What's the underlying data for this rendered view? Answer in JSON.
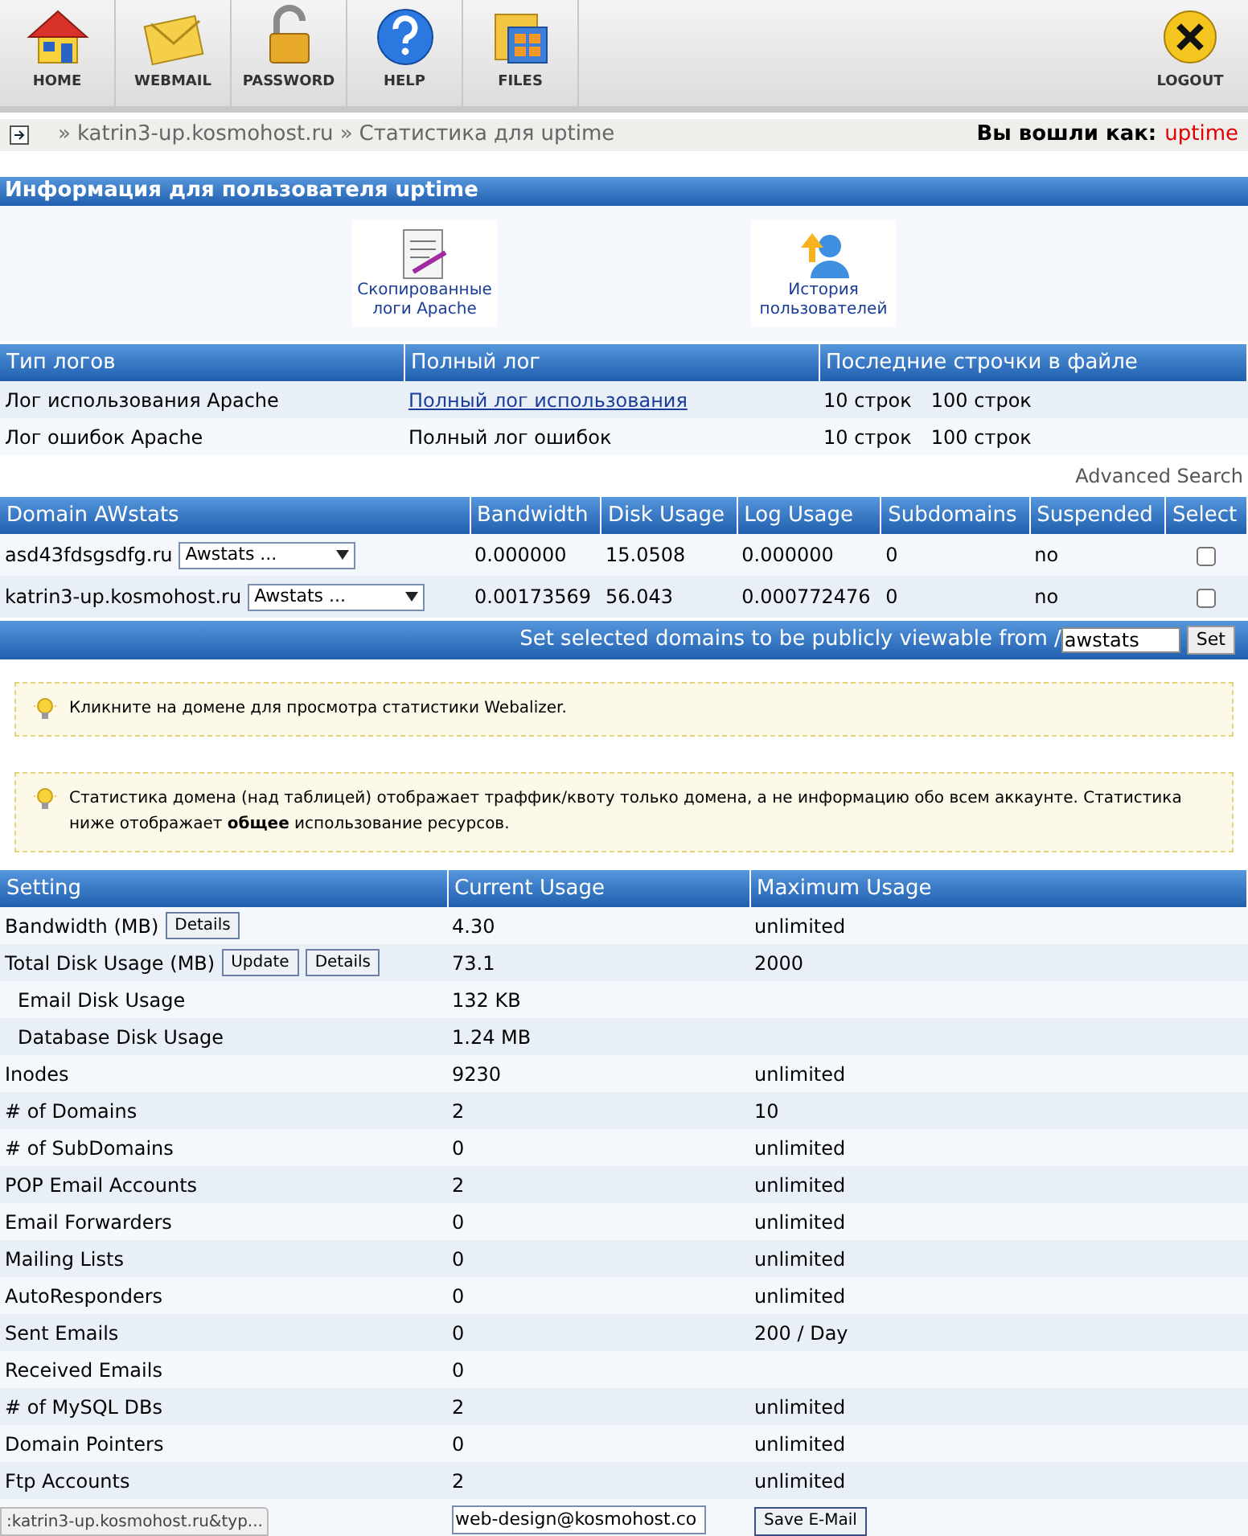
{
  "toolbar": {
    "items": [
      {
        "label": "HOME"
      },
      {
        "label": "WEBMAIL"
      },
      {
        "label": "PASSWORD"
      },
      {
        "label": "HELP"
      },
      {
        "label": "FILES"
      }
    ],
    "logout": {
      "label": "LOGOUT"
    }
  },
  "breadcrumb": {
    "separator": "»",
    "items": [
      "katrin3-up.kosmohost.ru",
      "Статистика для uptime"
    ],
    "logged_in_label": "Вы вошли как:",
    "user": "uptime"
  },
  "section_title": "Информация для пользователя uptime",
  "shortcuts": [
    {
      "label": "Скопированные логи Apache"
    },
    {
      "label": "История пользователей"
    }
  ],
  "logs_table": {
    "columns": [
      "Тип логов",
      "Полный лог",
      "Последние строчки в файле"
    ],
    "rows": [
      {
        "type": "Лог использования Apache",
        "full_log": "Полный лог использования",
        "kind": "link",
        "lines": [
          "10 строк",
          "100 строк"
        ]
      },
      {
        "type": "Лог ошибок Apache",
        "full_log": "Полный лог ошибок",
        "kind": "text",
        "lines": [
          "10 строк",
          "100 строк"
        ]
      }
    ]
  },
  "advanced_search": "Advanced Search",
  "domains_table": {
    "columns": [
      "Domain AWstats",
      "Bandwidth",
      "Disk Usage",
      "Log Usage",
      "Subdomains",
      "Suspended",
      "Select"
    ],
    "rows": [
      {
        "domain": "asd43fdsgsdfg.ru",
        "stats_select": "Awstats ...",
        "bandwidth": "0.000000",
        "disk": "15.0508",
        "log": "0.000000",
        "subdomains": "0",
        "suspended": "no",
        "checked": false
      },
      {
        "domain": "katrin3-up.kosmohost.ru",
        "stats_select": "Awstats ...",
        "bandwidth": "0.00173569",
        "disk": "56.043",
        "log": "0.000772476",
        "subdomains": "0",
        "suspended": "no",
        "checked": false
      }
    ]
  },
  "public_bar": {
    "label": "Set selected domains to be publicly viewable from /",
    "value": "awstats",
    "button": "Set"
  },
  "notes": [
    {
      "text": "Кликните на домене для просмотра статистики Webalizer."
    },
    {
      "text": "Статистика домена (над таблицей) отображает траффик/квоту только домена, а не информацию обо всем аккаунте. Статистика ниже отображает **общее** использование ресурсов."
    }
  ],
  "usage_table": {
    "columns": [
      "Setting",
      "Current Usage",
      "Maximum Usage"
    ],
    "rows": [
      {
        "setting": "Bandwidth (MB)",
        "indented": false,
        "buttons": [
          "Details"
        ],
        "current": "4.30",
        "maximum": "unlimited"
      },
      {
        "setting": "Total Disk Usage (MB)",
        "indented": false,
        "buttons": [
          "Update",
          "Details"
        ],
        "current": "73.1",
        "maximum": "2000"
      },
      {
        "setting": "Email Disk Usage",
        "indented": true,
        "current": "132 KB"
      },
      {
        "setting": "Database Disk Usage",
        "indented": true,
        "current": "1.24 MB"
      },
      {
        "setting": "Inodes",
        "indented": false,
        "current": "9230",
        "maximum": "unlimited"
      },
      {
        "setting": "# of Domains",
        "indented": false,
        "current": "2",
        "maximum": "10"
      },
      {
        "setting": "# of SubDomains",
        "indented": false,
        "current": "0",
        "maximum": "unlimited"
      },
      {
        "setting": "POP Email Accounts",
        "indented": false,
        "current": "2",
        "maximum": "unlimited"
      },
      {
        "setting": "Email Forwarders",
        "indented": false,
        "current": "0",
        "maximum": "unlimited"
      },
      {
        "setting": "Mailing Lists",
        "indented": false,
        "current": "0",
        "maximum": "unlimited"
      },
      {
        "setting": "AutoResponders",
        "indented": false,
        "current": "0",
        "maximum": "unlimited"
      },
      {
        "setting": "Sent Emails",
        "indented": false,
        "current": "0",
        "maximum": "200 / Day"
      },
      {
        "setting": "Received Emails",
        "indented": false,
        "current": "0"
      },
      {
        "setting": "# of MySQL DBs",
        "indented": false,
        "current": "2",
        "maximum": "unlimited"
      },
      {
        "setting": "Domain Pointers",
        "indented": false,
        "current": "0",
        "maximum": "unlimited"
      },
      {
        "setting": "Ftp Accounts",
        "indented": false,
        "current": "2",
        "maximum": "unlimited"
      }
    ]
  },
  "status_url": ":katrin3-up.kosmohost.ru&typ...",
  "email_field": {
    "value": "web-design@kosmohost.co",
    "button": "Save E-Mail"
  }
}
